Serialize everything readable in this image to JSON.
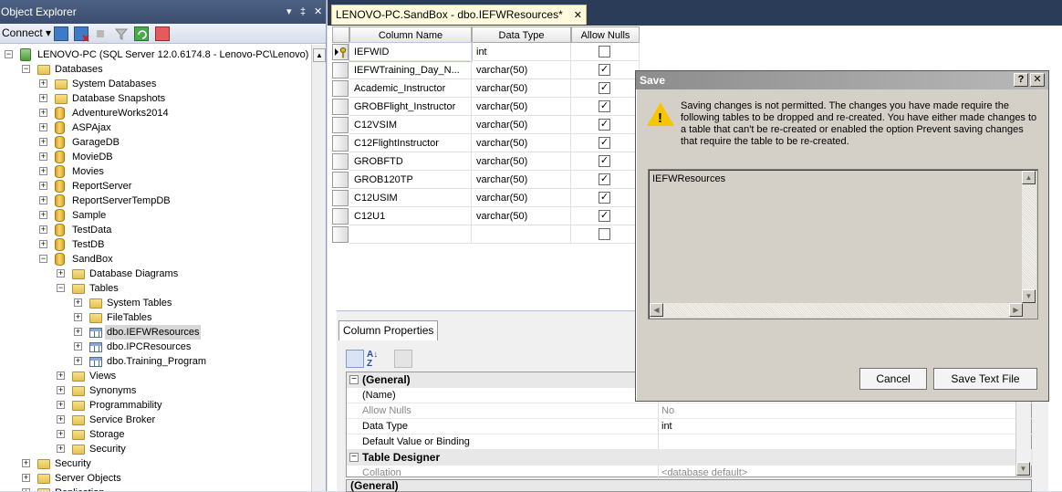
{
  "object_explorer": {
    "title": "Object Explorer",
    "title_controls": [
      "▾",
      "‡",
      "✕"
    ],
    "connect_label": "Connect ▾",
    "tree": [
      {
        "depth": 0,
        "expander": "−",
        "icon": "server",
        "label": "LENOVO-PC (SQL Server 12.0.6174.8 - Lenovo-PC\\Lenovo)"
      },
      {
        "depth": 1,
        "expander": "−",
        "icon": "folder",
        "label": "Databases"
      },
      {
        "depth": 2,
        "expander": "+",
        "icon": "folder",
        "label": "System Databases"
      },
      {
        "depth": 2,
        "expander": "+",
        "icon": "folder",
        "label": "Database Snapshots"
      },
      {
        "depth": 2,
        "expander": "+",
        "icon": "db",
        "label": "AdventureWorks2014"
      },
      {
        "depth": 2,
        "expander": "+",
        "icon": "db",
        "label": "ASPAjax"
      },
      {
        "depth": 2,
        "expander": "+",
        "icon": "db",
        "label": "GarageDB"
      },
      {
        "depth": 2,
        "expander": "+",
        "icon": "db",
        "label": "MovieDB"
      },
      {
        "depth": 2,
        "expander": "+",
        "icon": "db",
        "label": "Movies"
      },
      {
        "depth": 2,
        "expander": "+",
        "icon": "db",
        "label": "ReportServer"
      },
      {
        "depth": 2,
        "expander": "+",
        "icon": "db",
        "label": "ReportServerTempDB"
      },
      {
        "depth": 2,
        "expander": "+",
        "icon": "db",
        "label": "Sample"
      },
      {
        "depth": 2,
        "expander": "+",
        "icon": "db",
        "label": "TestData"
      },
      {
        "depth": 2,
        "expander": "+",
        "icon": "db",
        "label": "TestDB"
      },
      {
        "depth": 2,
        "expander": "−",
        "icon": "db",
        "label": "SandBox"
      },
      {
        "depth": 3,
        "expander": "+",
        "icon": "folder",
        "label": "Database Diagrams"
      },
      {
        "depth": 3,
        "expander": "−",
        "icon": "folder",
        "label": "Tables"
      },
      {
        "depth": 4,
        "expander": "+",
        "icon": "folder",
        "label": "System Tables"
      },
      {
        "depth": 4,
        "expander": "+",
        "icon": "folder",
        "label": "FileTables"
      },
      {
        "depth": 4,
        "expander": "+",
        "icon": "table",
        "label": "dbo.IEFWResources",
        "selected": true
      },
      {
        "depth": 4,
        "expander": "+",
        "icon": "table",
        "label": "dbo.IPCResources"
      },
      {
        "depth": 4,
        "expander": "+",
        "icon": "table",
        "label": "dbo.Training_Program"
      },
      {
        "depth": 3,
        "expander": "+",
        "icon": "folder",
        "label": "Views"
      },
      {
        "depth": 3,
        "expander": "+",
        "icon": "folder",
        "label": "Synonyms"
      },
      {
        "depth": 3,
        "expander": "+",
        "icon": "folder",
        "label": "Programmability"
      },
      {
        "depth": 3,
        "expander": "+",
        "icon": "folder",
        "label": "Service Broker"
      },
      {
        "depth": 3,
        "expander": "+",
        "icon": "folder",
        "label": "Storage"
      },
      {
        "depth": 3,
        "expander": "+",
        "icon": "folder",
        "label": "Security"
      },
      {
        "depth": 1,
        "expander": "+",
        "icon": "folder",
        "label": "Security"
      },
      {
        "depth": 1,
        "expander": "+",
        "icon": "folder",
        "label": "Server Objects"
      },
      {
        "depth": 1,
        "expander": "+",
        "icon": "folder",
        "label": "Replication"
      }
    ]
  },
  "document": {
    "tab_label": "LENOVO-PC.SandBox - dbo.IEFWResources*",
    "columns": {
      "name": "Column Name",
      "type": "Data Type",
      "nulls": "Allow Nulls"
    },
    "rows": [
      {
        "name": "IEFWID",
        "type": "int",
        "nulls": false,
        "key": true
      },
      {
        "name": "IEFWTraining_Day_N...",
        "type": "varchar(50)",
        "nulls": true
      },
      {
        "name": "Academic_Instructor",
        "type": "varchar(50)",
        "nulls": true
      },
      {
        "name": "GROBFlight_Instructor",
        "type": "varchar(50)",
        "nulls": true
      },
      {
        "name": "C12VSIM",
        "type": "varchar(50)",
        "nulls": true
      },
      {
        "name": "C12FlightInstructor",
        "type": "varchar(50)",
        "nulls": true
      },
      {
        "name": "GROBFTD",
        "type": "varchar(50)",
        "nulls": true
      },
      {
        "name": "GROB120TP",
        "type": "varchar(50)",
        "nulls": true
      },
      {
        "name": "C12USIM",
        "type": "varchar(50)",
        "nulls": true
      },
      {
        "name": "C12U1",
        "type": "varchar(50)",
        "nulls": true
      },
      {
        "name": "",
        "type": "",
        "nulls": false
      }
    ]
  },
  "column_properties": {
    "tab_label": "Column Properties",
    "rows": [
      {
        "kind": "cat",
        "name": "(General)"
      },
      {
        "kind": "prop",
        "name": "(Name)",
        "value": ""
      },
      {
        "kind": "prop",
        "name": "Allow Nulls",
        "value": "No",
        "gray": true
      },
      {
        "kind": "prop",
        "name": "Data Type",
        "value": "int"
      },
      {
        "kind": "prop",
        "name": "Default Value or Binding",
        "value": ""
      },
      {
        "kind": "cat",
        "name": "Table Designer"
      },
      {
        "kind": "prop",
        "name": "Collation",
        "value": "<database default>",
        "gray": true
      }
    ],
    "bottom_label": "(General)"
  },
  "save_dialog": {
    "title": "Save",
    "help_label": "?",
    "close_label": "✕",
    "message": "Saving changes is not permitted. The changes you have made require the following tables to be dropped and re-created. You have either made changes to a table that can't be re-created or enabled the option Prevent saving changes that require the table to be re-created.",
    "tables": [
      "IEFWResources"
    ],
    "cancel_label": "Cancel",
    "save_text_label": "Save Text File"
  }
}
